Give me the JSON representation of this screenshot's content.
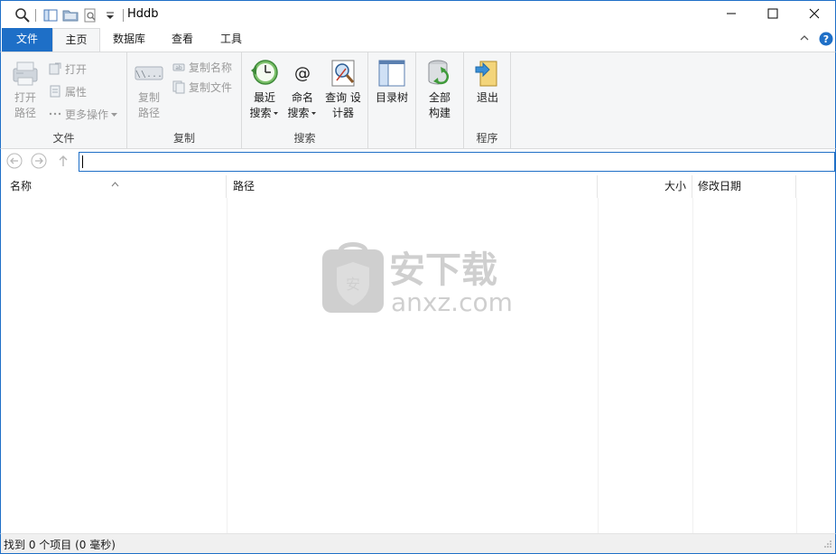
{
  "window": {
    "title": "Hddb"
  },
  "tabs": [
    {
      "label": "文件"
    },
    {
      "label": "主页"
    },
    {
      "label": "数据库"
    },
    {
      "label": "查看"
    },
    {
      "label": "工具"
    }
  ],
  "ribbon": {
    "file_group": {
      "label": "文件",
      "open_path": [
        "打开",
        "路径"
      ],
      "open": "打开",
      "properties": "属性",
      "more_actions": "更多操作"
    },
    "copy_group": {
      "label": "复制",
      "copy_path": [
        "复制",
        "路径"
      ],
      "copy_name": "复制名称",
      "copy_file": "复制文件"
    },
    "search_group": {
      "label": "搜索",
      "recent_search": [
        "最近",
        "搜索"
      ],
      "name_search": [
        "命名",
        "搜索"
      ],
      "query_designer": [
        "查询 设",
        "计器"
      ]
    },
    "tree_group": {
      "dir_tree": "目录树"
    },
    "build_group": {
      "full_build": [
        "全部",
        "构建"
      ]
    },
    "program_group": {
      "label": "程序",
      "exit": "退出"
    }
  },
  "address": {
    "value": ""
  },
  "columns": [
    {
      "label": "名称"
    },
    {
      "label": "路径"
    },
    {
      "label": "大小"
    },
    {
      "label": "修改日期"
    }
  ],
  "watermark": {
    "brand": "安下载",
    "domain": "anxz.com",
    "badge": "安"
  },
  "status": {
    "text": "找到 0 个项目 (0 毫秒)"
  },
  "colors": {
    "accent": "#1e6fc7",
    "ribbon_bg": "#f5f6f7"
  },
  "icons": [
    "search-icon",
    "properties-pane-icon",
    "folder-icon",
    "preview-icon",
    "customize-dropdown-icon",
    "minimize-icon",
    "maximize-icon",
    "close-icon",
    "collapse-ribbon-icon",
    "help-icon"
  ]
}
